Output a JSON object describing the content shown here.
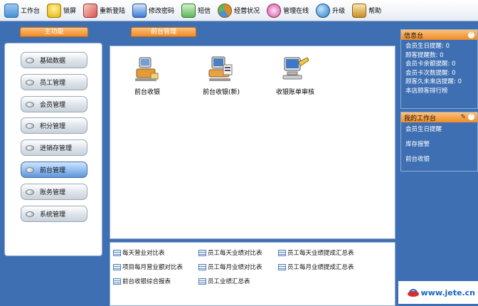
{
  "toolbar": {
    "items": [
      {
        "label": "工作台",
        "icon": "desk-icon",
        "color": "#4b8fd6"
      },
      {
        "label": "锁屏",
        "icon": "lock-icon",
        "color": "#e6b300"
      },
      {
        "label": "重新登陆",
        "icon": "relogin-icon",
        "color": "#d9534f"
      },
      {
        "label": "修改密码",
        "icon": "password-icon",
        "color": "#3a7bd5"
      },
      {
        "label": "短信",
        "icon": "sms-icon",
        "color": "#5cb85c"
      },
      {
        "label": "经营状况",
        "icon": "business-status-icon",
        "color": "#e08a2a"
      },
      {
        "label": "管理在线",
        "icon": "manage-online-icon",
        "color": "#d24fa3"
      },
      {
        "label": "升级",
        "icon": "upgrade-globe-icon",
        "color": "#2a7fc4"
      },
      {
        "label": "帮助",
        "icon": "help-icon",
        "color": "#c98f22"
      }
    ]
  },
  "left": {
    "title": "主功能",
    "menu": [
      {
        "label": "基础数据",
        "active": false
      },
      {
        "label": "员工管理",
        "active": false
      },
      {
        "label": "会员管理",
        "active": false
      },
      {
        "label": "积分管理",
        "active": false
      },
      {
        "label": "进销存管理",
        "active": false
      },
      {
        "label": "前台管理",
        "active": true
      },
      {
        "label": "账务管理",
        "active": false
      },
      {
        "label": "系统管理",
        "active": false
      }
    ]
  },
  "center": {
    "title": "前台管理",
    "modules": [
      {
        "label": "前台收银",
        "icon": "cashier-pc-icon"
      },
      {
        "label": "前台收银(新)",
        "icon": "cashier-new-pc-icon"
      },
      {
        "label": "收银账单审核",
        "icon": "bill-audit-icon"
      }
    ],
    "reports": [
      {
        "label": "每天营业对比表"
      },
      {
        "label": "员工每天业绩对比表"
      },
      {
        "label": "员工每天业绩提成汇总表"
      },
      {
        "label": "项目每月营业额对比表"
      },
      {
        "label": "员工每月业绩对比表"
      },
      {
        "label": "员工每月业绩提成汇总表"
      },
      {
        "label": "前台收银综合报表"
      },
      {
        "label": "员工业绩汇总表"
      }
    ]
  },
  "right": {
    "info_title": "信息台",
    "info_lines": [
      "会员生日提醒: 0",
      "顾客提醒数: 0",
      "会员卡余额提醒: 0",
      "会员卡次数提醒: 0",
      "顾客久未来店提醒: 0",
      "本店顾客排行榜"
    ],
    "work_title": "我的工作台",
    "work_items": [
      "会员生日提醒",
      "库存报警",
      "前台收银"
    ],
    "collapse_glyph": "⌃",
    "edit_glyph": "✎"
  },
  "watermark": {
    "text": "www.jete.cn"
  }
}
